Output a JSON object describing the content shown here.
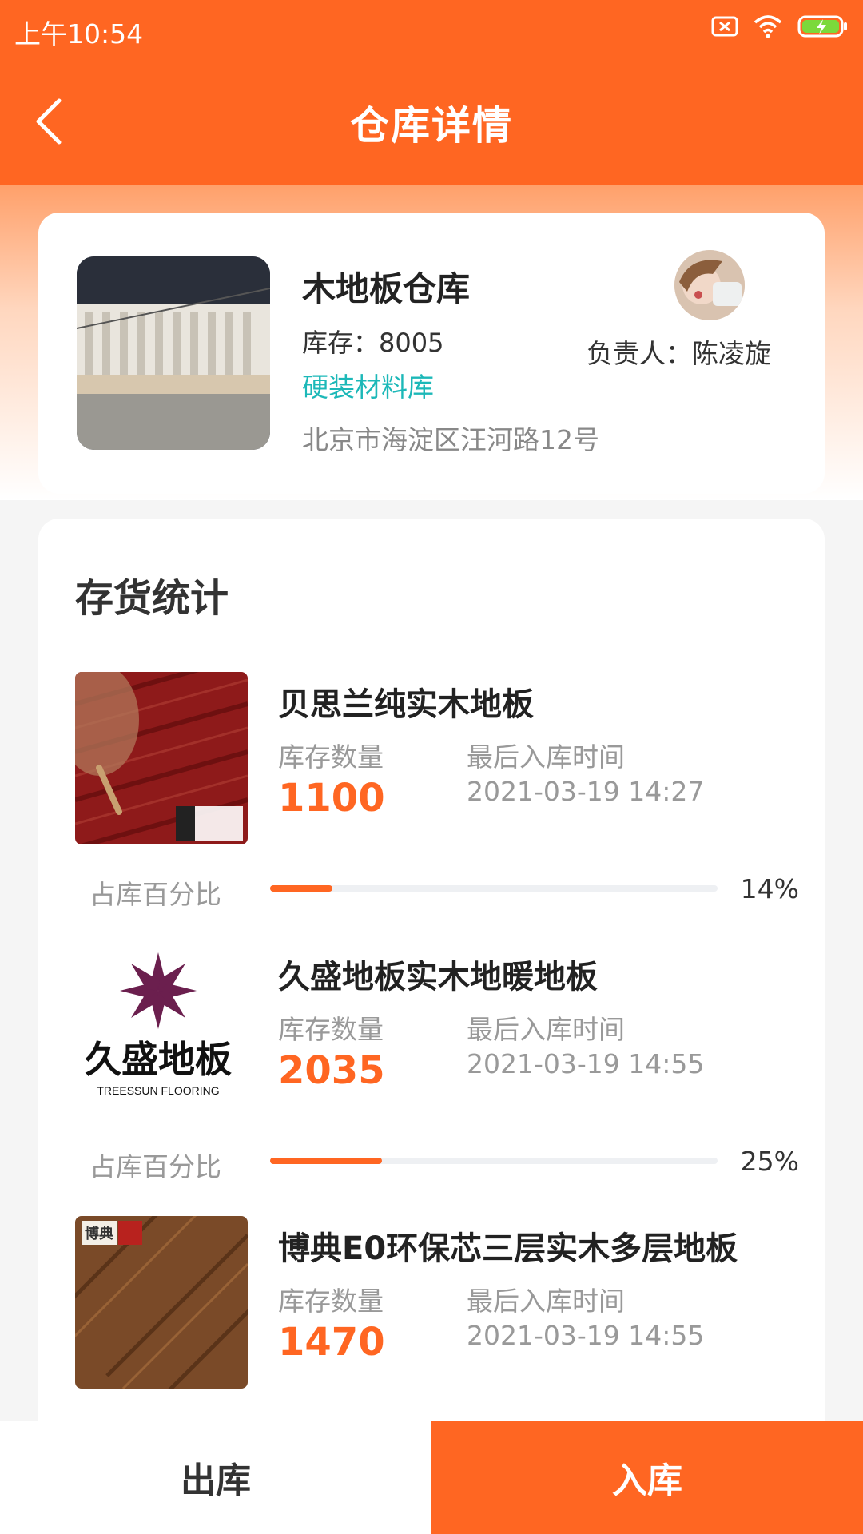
{
  "status_bar": {
    "time": "上午10:54"
  },
  "nav": {
    "title": "仓库详情"
  },
  "warehouse": {
    "name": "木地板仓库",
    "stock": "库存：8005",
    "category": "硬装材料库",
    "address": "北京市海淀区汪河路12号",
    "manager": "负责人：陈凌旋"
  },
  "inventory": {
    "title": "存货统计",
    "qty_label": "库存数量",
    "time_label": "最后入库时间",
    "percent_label": "占库百分比",
    "items": [
      {
        "name": "贝思兰纯实木地板",
        "qty": "1100",
        "time": "2021-03-19 14:27",
        "percent_text": "14%",
        "percent": 14
      },
      {
        "name": "久盛地板实木地暖地板",
        "qty": "2035",
        "time": "2021-03-19 14:55",
        "percent_text": "25%",
        "percent": 25,
        "logo_text": "久盛地板",
        "logo_sub": "TREESSUN FLOORING"
      },
      {
        "name": "博典E0环保芯三层实木多层地板",
        "qty": "1470",
        "time": "2021-03-19 14:55",
        "logo_text": "博典"
      }
    ]
  },
  "actions": {
    "out_label": "出库",
    "in_label": "入库"
  },
  "colors": {
    "accent": "#ff6622",
    "teal": "#1cb8b8"
  }
}
